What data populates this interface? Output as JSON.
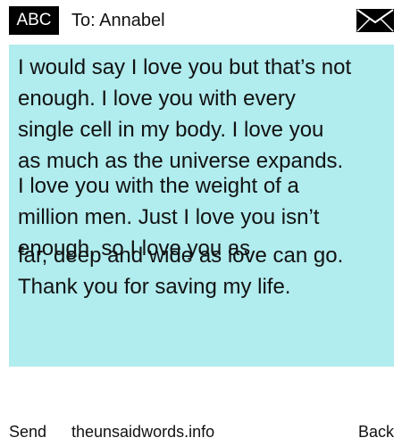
{
  "header": {
    "badge_label": "ABC",
    "to_label": "To: Annabel",
    "icon": "envelope-icon"
  },
  "message": {
    "background": "#b1ecee",
    "part_1": "I would say I love you but that’s not\nenough. I love you with every\nsingle cell in my body. I love you\nas much as the universe expands.",
    "part_2": "I love you with the weight of a\nmillion men. Just I love you isn’t\nenough, so I love you as",
    "part_3": "far, deep and wide as love can go.\nThank you for saving my life."
  },
  "footer": {
    "send_label": "Send",
    "site_label": "theunsaidwords.info",
    "back_label": "Back"
  }
}
